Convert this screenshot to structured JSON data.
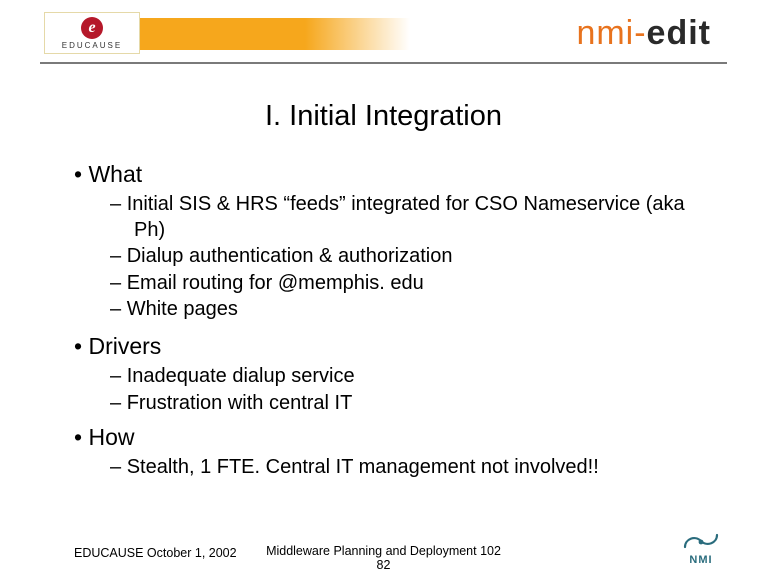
{
  "header": {
    "educause_label": "EDUCAUSE",
    "educause_e": "e",
    "brand_prefix": "nmi-",
    "brand_suffix": "edit"
  },
  "title": "I. Initial Integration",
  "sections": {
    "what": {
      "heading": "What",
      "items": [
        "Initial SIS & HRS “feeds” integrated for CSO Nameservice (aka Ph)",
        "Dialup authentication & authorization",
        "Email routing for @memphis. edu",
        "White pages"
      ]
    },
    "drivers": {
      "heading": "Drivers",
      "items": [
        "Inadequate dialup service",
        "Frustration with central IT"
      ]
    },
    "how": {
      "heading": "How",
      "items": [
        "Stealth, 1 FTE. Central IT management not involved!!"
      ]
    }
  },
  "footer": {
    "left": "EDUCAUSE October 1, 2002",
    "center_line1": "Middleware Planning and Deployment 102",
    "center_line2": "82",
    "nmi": "NMI"
  }
}
